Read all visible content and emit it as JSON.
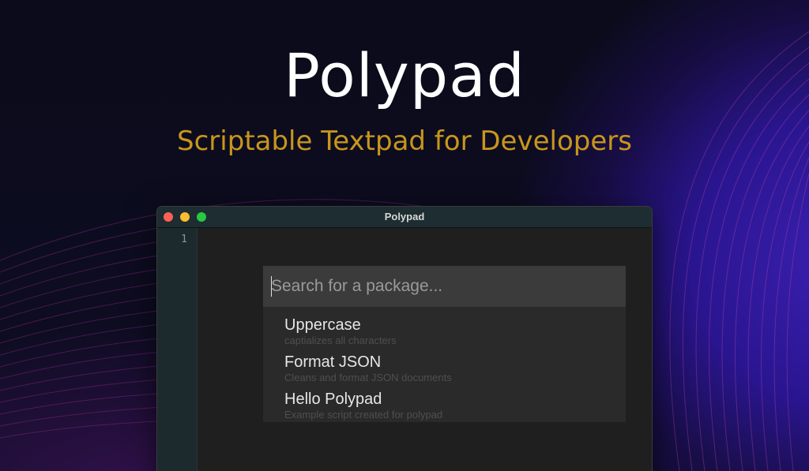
{
  "hero": {
    "title": "Polypad",
    "subtitle": "Scriptable Textpad for Developers"
  },
  "colors": {
    "title": "#ffffff",
    "subtitle": "#c8961c",
    "close": "#fe5f57",
    "minimize": "#febc2e",
    "maximize": "#28c840"
  },
  "window": {
    "title": "Polypad",
    "line_numbers": [
      "1"
    ]
  },
  "search": {
    "placeholder": "Search for a package...",
    "value": ""
  },
  "results": [
    {
      "name": "Uppercase",
      "description": "captializes all characters"
    },
    {
      "name": "Format JSON",
      "description": "Cleans and format JSON documents"
    },
    {
      "name": "Hello Polypad",
      "description": "Example script created for polypad"
    }
  ]
}
